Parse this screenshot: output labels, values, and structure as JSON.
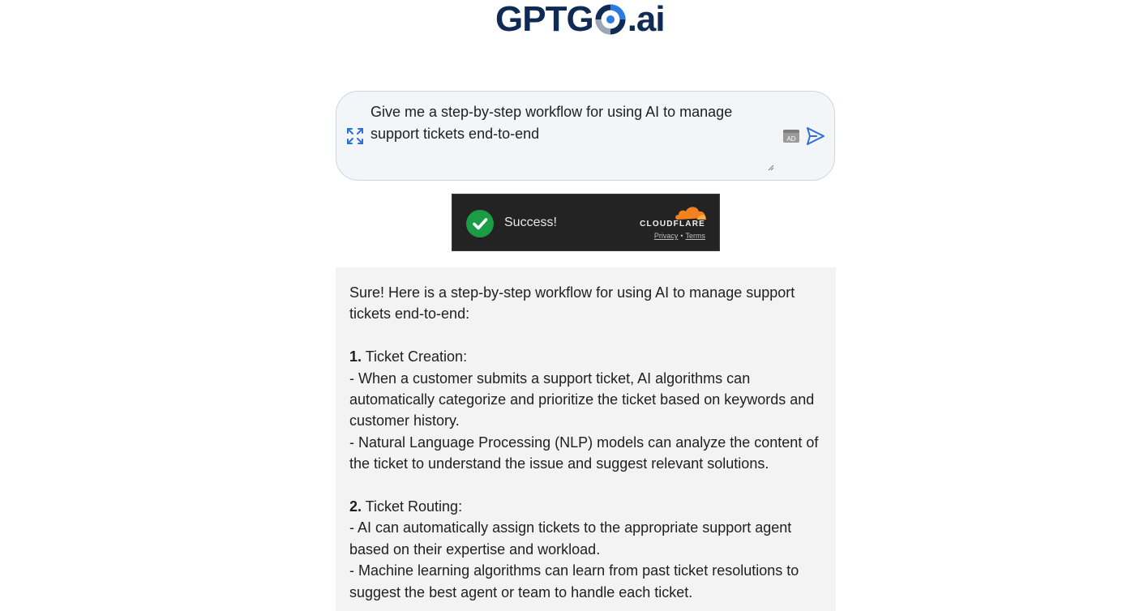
{
  "logo": {
    "left_text": "GPTG",
    "right_text": ".ai",
    "colors": {
      "navy": "#0f2a55",
      "blue": "#2a7be4",
      "gray": "#9aa7b6"
    }
  },
  "prompt": {
    "text": "Give me a step-by-step workflow for using AI to manage\nsupport tickets end-to-end",
    "icons": [
      "expand-icon",
      "ad-icon",
      "send-icon"
    ]
  },
  "cloudflare": {
    "status": "Success!",
    "brand": "CLOUDFLARE",
    "privacy": "Privacy",
    "separator": "•",
    "terms": "Terms",
    "colors": {
      "background": "#232323",
      "check": "#1a9e45",
      "cloud": "#f48120"
    }
  },
  "response": {
    "intro": "Sure! Here is a step-by-step workflow for using AI to manage support tickets end-to-end:",
    "sections": [
      {
        "number": "1.",
        "title": " Ticket Creation:",
        "bullets": [
          "- When a customer submits a support ticket, AI algorithms can automatically categorize and prioritize the ticket based on keywords and customer history.",
          "- Natural Language Processing (NLP) models can analyze the content of the ticket to understand the issue and suggest relevant solutions."
        ]
      },
      {
        "number": "2.",
        "title": " Ticket Routing:",
        "bullets": [
          "- AI can automatically assign tickets to the appropriate support agent based on their expertise and workload.",
          "- Machine learning algorithms can learn from past ticket resolutions to suggest the best agent or team to handle each ticket."
        ]
      }
    ]
  }
}
